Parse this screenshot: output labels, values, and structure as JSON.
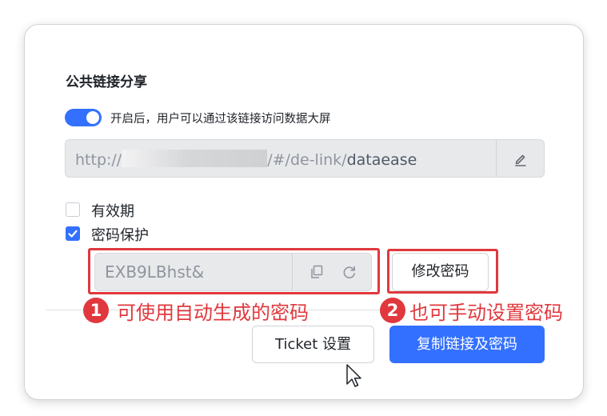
{
  "share": {
    "title": "公共链接分享",
    "toggle_on": true,
    "toggle_description": "开启后，用户可以通过该链接访问数据大屏",
    "link": {
      "prefix": "http://",
      "path": "/#/de-link/",
      "slug": "dataease"
    },
    "validity": {
      "label": "有效期",
      "checked": false
    },
    "password_protect": {
      "label": "密码保护",
      "checked": true,
      "value": "EXB9LBhst&"
    },
    "change_password_label": "修改密码"
  },
  "footer": {
    "ticket_button": "Ticket 设置",
    "copy_button": "复制链接及密码"
  },
  "annotations": [
    {
      "number": "1",
      "text": "可使用自动生成的密码"
    },
    {
      "number": "2",
      "text": "也可手动设置密码"
    }
  ],
  "colors": {
    "primary": "#3370ff",
    "annotation_red": "#e0383e"
  }
}
